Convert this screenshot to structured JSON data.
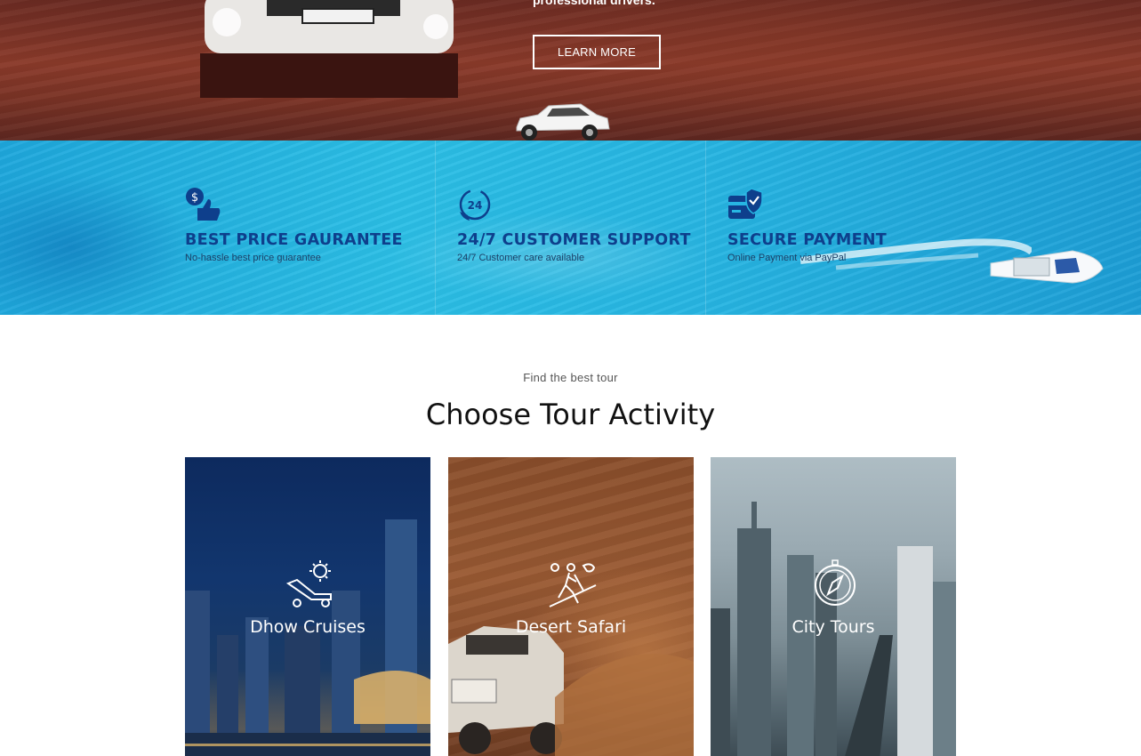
{
  "hero": {
    "subtitle": "professional drivers.",
    "learn_more_label": "LEARN MORE"
  },
  "features": [
    {
      "icon": "price-thumbs-up-icon",
      "title": "BEST PRICE GAURANTEE",
      "text": "No-hassle best price guarantee"
    },
    {
      "icon": "support-24-icon",
      "title": "24/7 CUSTOMER SUPPORT",
      "text": "24/7 Customer care available"
    },
    {
      "icon": "secure-payment-icon",
      "title": "SECURE PAYMENT",
      "text": "Online Payment via PayPal"
    }
  ],
  "tours": {
    "subtitle": "Find the best tour",
    "title": "Choose Tour Activity",
    "cards": [
      {
        "icon": "sunbed-icon",
        "label": "Dhow Cruises"
      },
      {
        "icon": "hiker-icon",
        "label": "Desert Safari"
      },
      {
        "icon": "compass-icon",
        "label": "City Tours"
      }
    ]
  },
  "colors": {
    "feature_title": "#0e3f8c",
    "feature_bg": "#27b6e3",
    "hero_bg": "#7a3325"
  }
}
